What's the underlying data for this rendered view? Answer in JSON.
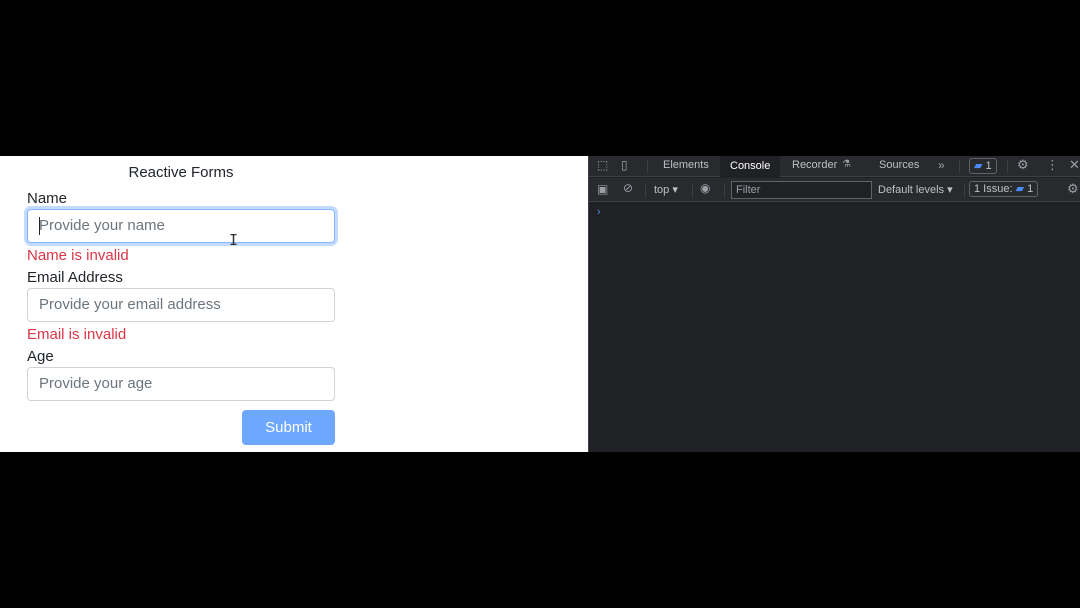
{
  "form": {
    "title": "Reactive Forms",
    "name_label": "Name",
    "name_placeholder": "Provide your name",
    "name_error": "Name is invalid",
    "email_label": "Email Address",
    "email_placeholder": "Provide your email address",
    "email_error": "Email is invalid",
    "age_label": "Age",
    "age_placeholder": "Provide your age",
    "submit_label": "Submit"
  },
  "devtools": {
    "tabs": [
      "Elements",
      "Console",
      "Recorder",
      "Sources"
    ],
    "active_tab": "Console",
    "more_tabs": "»",
    "messages_badge": "1",
    "context": "top",
    "filter_placeholder": "Filter",
    "levels": "Default levels",
    "issues_label": "1 Issue:",
    "issues_count": "1",
    "prompt": "›"
  },
  "colors": {
    "error": "#dc3545",
    "primary_disabled": "#6ea8fe",
    "focus_ring": "#86b7fe",
    "devtools_bg": "#202124"
  }
}
